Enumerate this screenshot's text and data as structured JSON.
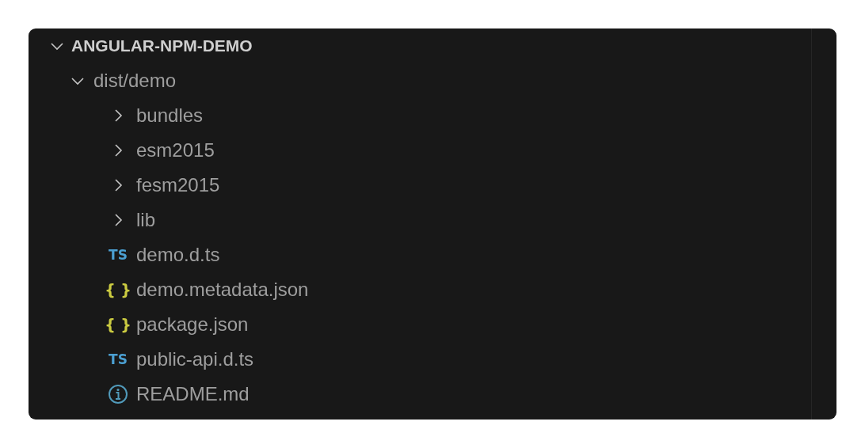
{
  "explorer": {
    "root": {
      "label": "ANGULAR-NPM-DEMO",
      "expanded": true,
      "children": [
        {
          "label": "dist/demo",
          "kind": "folder",
          "expanded": true,
          "children": [
            {
              "label": "bundles",
              "kind": "folder",
              "expanded": false
            },
            {
              "label": "esm2015",
              "kind": "folder",
              "expanded": false
            },
            {
              "label": "fesm2015",
              "kind": "folder",
              "expanded": false
            },
            {
              "label": "lib",
              "kind": "folder",
              "expanded": false
            },
            {
              "label": "demo.d.ts",
              "kind": "ts",
              "icon_text": "TS"
            },
            {
              "label": "demo.metadata.json",
              "kind": "json",
              "icon_text": "{ }"
            },
            {
              "label": "package.json",
              "kind": "json",
              "icon_text": "{ }"
            },
            {
              "label": "public-api.d.ts",
              "kind": "ts",
              "icon_text": "TS"
            },
            {
              "label": "README.md",
              "kind": "info"
            }
          ]
        }
      ]
    }
  }
}
